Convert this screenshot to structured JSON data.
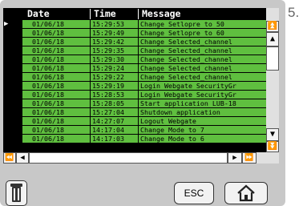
{
  "step_number": "5.",
  "table": {
    "headers": {
      "date": "Date",
      "time": "Time",
      "message": "Message"
    },
    "pointer": "▶",
    "rows": [
      {
        "date": "01/06/18",
        "time": "15:29:53",
        "message": "Change Setlopre to 50"
      },
      {
        "date": "01/06/18",
        "time": "15:29:49",
        "message": "Change Setlopre to 60"
      },
      {
        "date": "01/06/18",
        "time": "15:29:42",
        "message": "Change Selected_channel"
      },
      {
        "date": "01/06/18",
        "time": "15:29:35",
        "message": "Change Selected_channel"
      },
      {
        "date": "01/06/18",
        "time": "15:29:30",
        "message": "Change Selected_channel"
      },
      {
        "date": "01/06/18",
        "time": "15:29:24",
        "message": "Change Selected_channel"
      },
      {
        "date": "01/06/18",
        "time": "15:29:22",
        "message": "Change Selected_channel"
      },
      {
        "date": "01/06/18",
        "time": "15:29:19",
        "message": "Login Webgate SecurityGr"
      },
      {
        "date": "01/06/18",
        "time": "15:28:53",
        "message": "Login Webgate SecurityGr"
      },
      {
        "date": "01/06/18",
        "time": "15:28:05",
        "message": "Start application LUB-18"
      },
      {
        "date": "01/06/18",
        "time": "15:27:04",
        "message": "Shutdown application"
      },
      {
        "date": "01/06/18",
        "time": "14:27:07",
        "message": "Logout Webgate"
      },
      {
        "date": "01/06/18",
        "time": "14:17:04",
        "message": "Change Mode to 7"
      },
      {
        "date": "01/06/18",
        "time": "14:17:03",
        "message": "Change Mode to 6"
      }
    ]
  },
  "scroll": {
    "page_up": "⏫",
    "line_up": "▲",
    "line_down": "▼",
    "page_down": "⏬",
    "page_left": "⏪",
    "line_left": "◀",
    "line_right": "▶",
    "page_right": "⏩"
  },
  "buttons": {
    "esc_label": "ESC"
  },
  "icons": {
    "trash": "trash-icon",
    "home": "home-icon"
  },
  "colors": {
    "row_bg": "#5fbf3f",
    "header_bg": "#000000",
    "panel_bg": "#c8c8c8"
  }
}
